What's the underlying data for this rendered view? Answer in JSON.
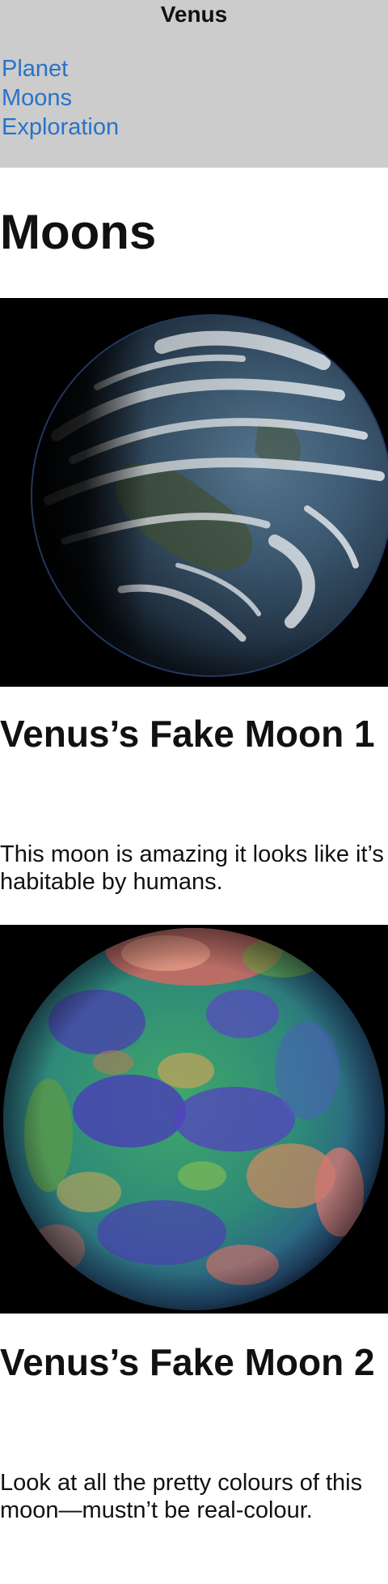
{
  "header": {
    "title": "Venus",
    "nav": [
      {
        "label": "Planet"
      },
      {
        "label": "Moons"
      },
      {
        "label": "Exploration"
      }
    ]
  },
  "main": {
    "heading": "Moons",
    "moons": [
      {
        "title": "Venus’s Fake Moon 1",
        "description": "This moon is amazing it looks like it’s habitable by humans."
      },
      {
        "title": "Venus’s Fake Moon 2",
        "description": "Look at all the pretty colours of this moon—mustn’t be real-colour."
      }
    ]
  },
  "colors": {
    "header_bg": "#cccccc",
    "link": "#2a72c9",
    "image_bg": "#000000"
  }
}
